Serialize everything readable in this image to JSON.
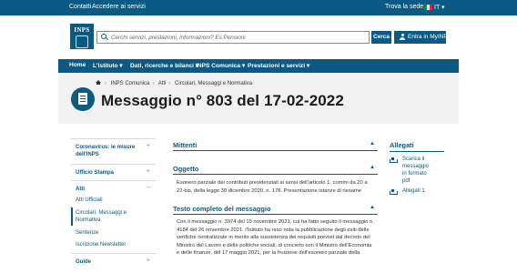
{
  "topbar": {
    "contatti": "Contatti",
    "accedere": "Accedere ai servizi",
    "trova_sede": "Trova la sede",
    "lang": "IT",
    "flag_colors": [
      "#009246",
      "#ffffff",
      "#ce2b37"
    ]
  },
  "header": {
    "logo_text": "INPS",
    "search_placeholder": "Cerchi servizi, prestazioni, informazioni? Es.Pensioni",
    "search_button": "Cerca",
    "login_button": "Entra in MyINPS"
  },
  "nav": {
    "items": [
      "Home",
      "L'Istituto",
      "Dati, ricerche e bilanci",
      "INPS Comunica",
      "Prestazioni e servizi"
    ]
  },
  "breadcrumb": {
    "items": [
      "INPS Comunica",
      "Atti",
      "Circolari, Messaggi e Normativa"
    ]
  },
  "page": {
    "title": "Messaggio n° 803 del 17-02-2022"
  },
  "sidebar": {
    "sections": [
      {
        "label": "Coronavirus: le misure dell'INPS",
        "toggle": "+"
      },
      {
        "label": "Ufficio Stampa",
        "toggle": "+"
      },
      {
        "label": "Atti",
        "toggle": "−"
      },
      {
        "label": "Guide",
        "toggle": "+"
      }
    ],
    "subitems": [
      "Atti Ufficiali",
      "Circolari, Messaggi e Normativa",
      "Sentenze",
      "Iscrizione Newsletter"
    ]
  },
  "content": {
    "mittenti": "Mittenti",
    "oggetto": "Oggetto",
    "oggetto_text": "Esonero parziale dei contributi previdenziali ai sensi dell'articolo 1, commi da 20 a 22-bis, della legge 30 dicembre 2020, n. 178. Presentazione istanze di riesame",
    "testo_heading": "Testo completo del messaggio",
    "testo_text": "Con il messaggio n. 3974 del 15 novembre 2021, cui ha fatto seguito il messaggio n. 4184 del 26 novembre 2021, l'Istituto ha reso nota la pubblicazione degli esiti delle verifiche centralizzate in merito alla sussistenza dei requisiti previsti dal decreto del Ministro del Lavoro e delle politiche sociali, di concerto con il Ministro dell'Economia e delle finanze, del 17 maggio 2021, per la fruizione dell'esonero parziale della"
  },
  "allegati": {
    "title": "Allegati",
    "items": [
      "Scarica il",
      "messaggio",
      "in formato",
      "pdf",
      "Allegati 1"
    ]
  }
}
